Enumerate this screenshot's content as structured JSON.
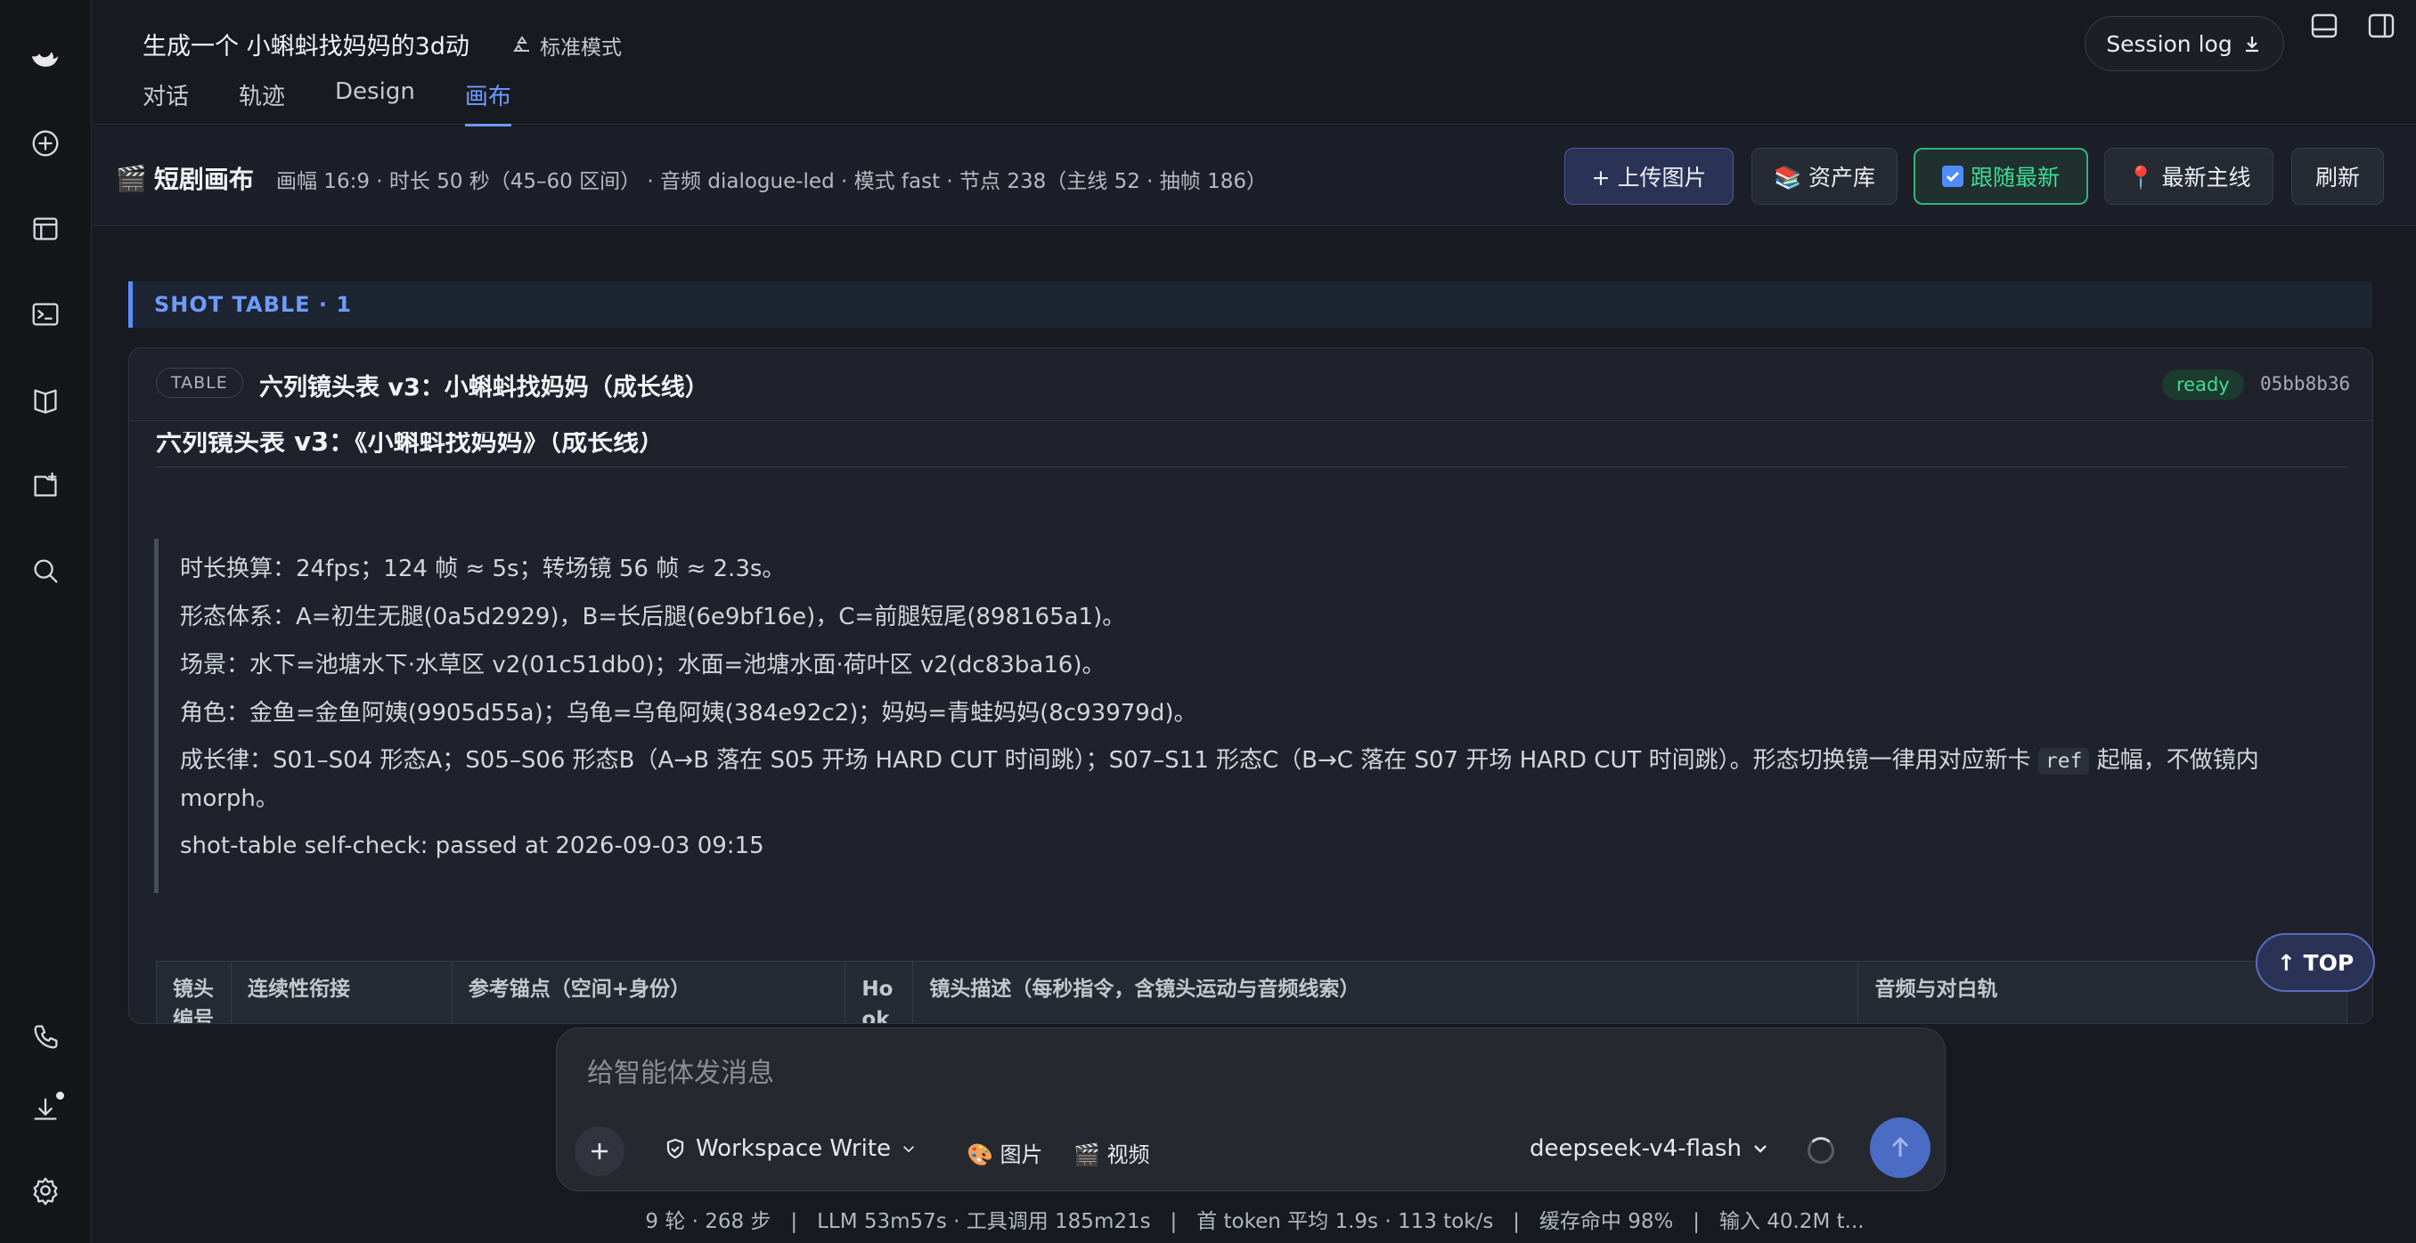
{
  "header": {
    "title": "生成一个 小蝌蚪找妈妈的3d动",
    "mode": "标准模式",
    "tabs": [
      "对话",
      "轨迹",
      "Design",
      "画布"
    ],
    "active_tab": "画布",
    "session_log": "Session log"
  },
  "canvas_bar": {
    "title": "短剧画布",
    "meta": "画幅 16:9 · 时长 50 秒（45–60 区间） · 音频 dialogue-led · 模式 fast · 节点 238（主线 52 · 抽帧 186）",
    "buttons": {
      "upload": "+ 上传图片",
      "assets": "📚 资产库",
      "follow": "跟随最新",
      "latest": "📍 最新主线",
      "refresh": "刷新"
    }
  },
  "section_label": "SHOT TABLE · 1",
  "card": {
    "badge": "TABLE",
    "title": "六列镜头表 v3：小蝌蚪找妈妈（成长线）",
    "status": "ready",
    "hash": "05bb8b36",
    "doc_heading": "六列镜头表 v3：《小蝌蚪找妈妈》（成长线）",
    "quote_lines": [
      "时长换算：24fps；124 帧 ≈ 5s；转场镜 56 帧 ≈ 2.3s。",
      "形态体系：A=初生无腿(0a5d2929)，B=长后腿(6e9bf16e)，C=前腿短尾(898165a1)。",
      "场景：水下=池塘水下·水草区 v2(01c51db0)；水面=池塘水面·荷叶区 v2(dc83ba16)。",
      "角色：金鱼=金鱼阿姨(9905d55a)；乌龟=乌龟阿姨(384e92c2)；妈妈=青蛙妈妈(8c93979d)。"
    ],
    "growth_line_pre": "成长律：S01–S04 形态A；S05–S06 形态B（A→B 落在 S05 开场 HARD CUT 时间跳）；S07–S11 形态C（B→C 落在 S07 开场 HARD CUT 时间跳）。形态切换镜一律用对应新卡 ",
    "growth_line_code": "ref",
    "growth_line_post": " 起幅，不做镜内 morph。",
    "selfcheck": "shot-table self-check: passed at 2026-09-03 09:15",
    "table_headers": [
      "镜头编号",
      "连续性衔接",
      "参考锚点（空间+身份）",
      "Hook",
      "镜头描述（每秒指令，含镜头运动与音频线索）",
      "音频与对白轨"
    ]
  },
  "top_button": "↑ TOP",
  "composer": {
    "placeholder": "给智能体发消息",
    "workspace": "Workspace Write",
    "image_chip": "🎨 图片",
    "video_chip": "🎬 视频",
    "model": "deepseek-v4-flash"
  },
  "footer": "9 轮 · 268 步   |   LLM 53m57s · 工具调用 185m21s   |   首 token 平均 1.9s · 113 tok/s   |   缓存命中 98%   |   输入 40.2M t..."
}
